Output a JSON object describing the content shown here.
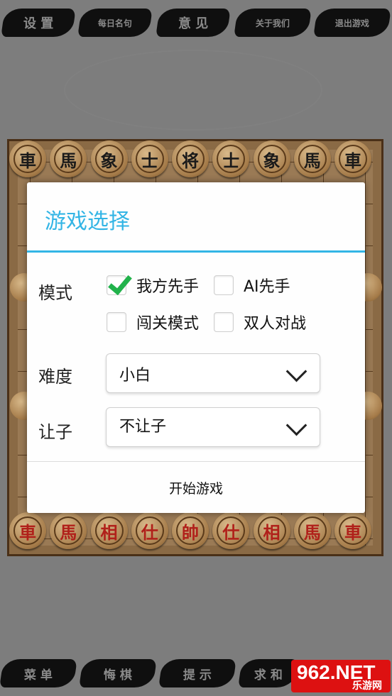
{
  "top_menu": [
    "设 置",
    "每日名句",
    "意 见",
    "关于我们",
    "退出游戏"
  ],
  "board": {
    "top_row": [
      "車",
      "馬",
      "象",
      "士",
      "将",
      "士",
      "象",
      "馬",
      "車"
    ],
    "bottom_row": [
      "車",
      "馬",
      "相",
      "仕",
      "帥",
      "仕",
      "相",
      "馬",
      "車"
    ]
  },
  "dialog": {
    "title": "游戏选择",
    "mode_label": "模式",
    "options": [
      {
        "label": "我方先手",
        "checked": true
      },
      {
        "label": "AI先手",
        "checked": false
      },
      {
        "label": "闯关模式",
        "checked": false
      },
      {
        "label": "双人对战",
        "checked": false
      }
    ],
    "difficulty_label": "难度",
    "difficulty_value": "小白",
    "handicap_label": "让子",
    "handicap_value": "不让子",
    "start_button": "开始游戏"
  },
  "bottom_menu": [
    "菜 单",
    "悔 棋",
    "提 示",
    "求 和"
  ],
  "watermark": {
    "main": "962.NET",
    "sub": "乐游网"
  },
  "colors": {
    "accent": "#33b5e5",
    "check": "#21b24b",
    "red_piece": "#b0201a"
  }
}
